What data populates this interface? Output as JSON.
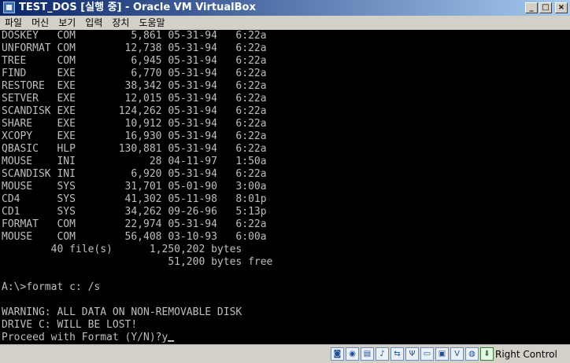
{
  "window": {
    "title": "TEST_DOS [실행 중] - Oracle VM VirtualBox",
    "min_glyph": "_",
    "max_glyph": "□",
    "close_glyph": "×"
  },
  "menu": [
    "파일",
    "머신",
    "보기",
    "입력",
    "장치",
    "도움말"
  ],
  "terminal": {
    "lines": [
      "DOSKEY   COM         5,861 05-31-94   6:22a",
      "UNFORMAT COM        12,738 05-31-94   6:22a",
      "TREE     COM         6,945 05-31-94   6:22a",
      "FIND     EXE         6,770 05-31-94   6:22a",
      "RESTORE  EXE        38,342 05-31-94   6:22a",
      "SETVER   EXE        12,015 05-31-94   6:22a",
      "SCANDISK EXE       124,262 05-31-94   6:22a",
      "SHARE    EXE        10,912 05-31-94   6:22a",
      "XCOPY    EXE        16,930 05-31-94   6:22a",
      "QBASIC   HLP       130,881 05-31-94   6:22a",
      "MOUSE    INI            28 04-11-97   1:50a",
      "SCANDISK INI         6,920 05-31-94   6:22a",
      "MOUSE    SYS        31,701 05-01-90   3:00a",
      "CD4      SYS        41,302 05-11-98   8:01p",
      "CD1      SYS        34,262 09-26-96   5:13p",
      "FORMAT   COM        22,974 05-31-94   6:22a",
      "MOUSE    COM        56,408 03-10-93   6:00a",
      "        40 file(s)      1,250,202 bytes",
      "                           51,200 bytes free",
      "",
      "A:\\>format c: /s",
      "",
      "WARNING: ALL DATA ON NON-REMOVABLE DISK",
      "DRIVE C: WILL BE LOST!",
      "Proceed with Format (Y/N)?y"
    ]
  },
  "statusbar": {
    "icons": [
      {
        "name": "hard-disk-icon",
        "glyph": "◙"
      },
      {
        "name": "optical-drive-icon",
        "glyph": "◉"
      },
      {
        "name": "floppy-drive-icon",
        "glyph": "▤"
      },
      {
        "name": "audio-icon",
        "glyph": "♪"
      },
      {
        "name": "network-icon",
        "glyph": "⇆"
      },
      {
        "name": "usb-icon",
        "glyph": "Ψ"
      },
      {
        "name": "shared-folder-icon",
        "glyph": "▭"
      },
      {
        "name": "display-icon",
        "glyph": "▣"
      },
      {
        "name": "video-capture-icon",
        "glyph": "V"
      },
      {
        "name": "mouse-integration-icon",
        "glyph": "◍"
      },
      {
        "name": "host-key-indicator-icon",
        "glyph": "⬇"
      }
    ],
    "host_key": "Right Control"
  }
}
